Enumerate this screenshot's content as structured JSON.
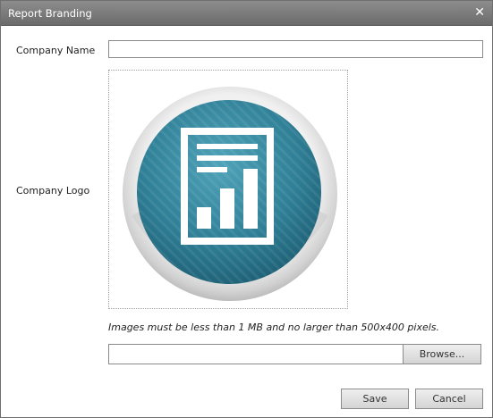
{
  "dialog": {
    "title": "Report Branding",
    "close_icon": "close-icon"
  },
  "form": {
    "company_name_label": "Company Name",
    "company_name_value": "",
    "company_logo_label": "Company Logo",
    "logo_icon": "report-chart-icon",
    "hint": "Images must be less than 1 MB and no larger than 500x400 pixels.",
    "file_value": "",
    "browse_label": "Browse..."
  },
  "actions": {
    "save_label": "Save",
    "cancel_label": "Cancel"
  },
  "colors": {
    "titlebar": "#7b7b7b",
    "logo_teal": "#2d7f96"
  }
}
